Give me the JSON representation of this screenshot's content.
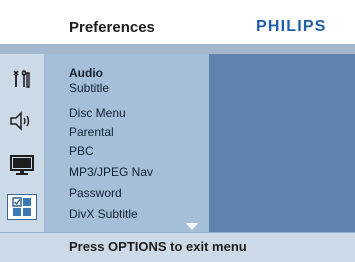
{
  "header": {
    "title": "Preferences",
    "brand": "PHILIPS",
    "brand_color": "#1f5ea8"
  },
  "sidebar": {
    "icons": [
      {
        "name": "general-setup-icon",
        "selected": false
      },
      {
        "name": "audio-setup-icon",
        "selected": false
      },
      {
        "name": "video-setup-icon",
        "selected": false
      },
      {
        "name": "preferences-icon",
        "selected": true
      }
    ]
  },
  "menu": {
    "items": [
      {
        "label": "Audio",
        "active": true
      },
      {
        "label": "Subtitle",
        "active": false
      },
      {
        "label": "Disc Menu",
        "active": false
      },
      {
        "label": "Parental",
        "active": false
      },
      {
        "label": "PBC",
        "active": false
      },
      {
        "label": "MP3/JPEG Nav",
        "active": false
      },
      {
        "label": "Password",
        "active": false
      },
      {
        "label": "DivX Subtitle",
        "active": false
      }
    ],
    "has_more": true
  },
  "footer": {
    "hint": "Press OPTIONS to exit menu"
  },
  "colors": {
    "menu_panel": "#a6bfd9",
    "value_panel": "#5f84ae",
    "sidebar": "#ccd9e6"
  }
}
